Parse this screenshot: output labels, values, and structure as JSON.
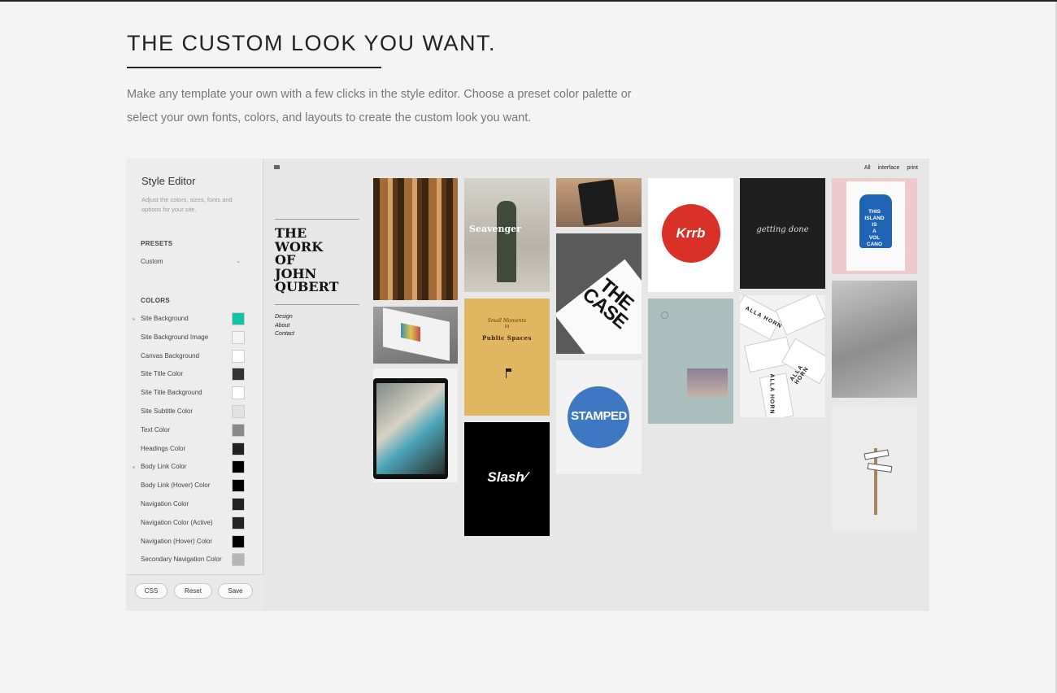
{
  "hero": {
    "title": "THE CUSTOM LOOK YOU WANT.",
    "body": "Make any template your own with a few clicks in the style editor. Choose a preset color palette or select your own fonts, colors, and layouts to create the custom look you want."
  },
  "style_editor": {
    "title": "Style Editor",
    "description": "Adjust the colors, sizes, fonts and options for your site.",
    "presets_heading": "PRESETS",
    "preset_value": "Custom",
    "colors_heading": "COLORS",
    "colors": [
      {
        "label": "Site Background",
        "color": "#10c3a4"
      },
      {
        "label": "Site Background Image",
        "color": "#f4f4f4"
      },
      {
        "label": "Canvas Background",
        "color": "#ffffff"
      },
      {
        "label": "Site Title Color",
        "color": "#333333"
      },
      {
        "label": "Site Title Background",
        "color": "#ffffff"
      },
      {
        "label": "Site Subtitle Color",
        "color": "#e2e2e2"
      },
      {
        "label": "Text Color",
        "color": "#8a8a8a"
      },
      {
        "label": "Headings Color",
        "color": "#222222"
      },
      {
        "label": "Body Link Color",
        "color": "#000000"
      },
      {
        "label": "Body Link (Hover) Color",
        "color": "#000000"
      },
      {
        "label": "Navigation Color",
        "color": "#222222"
      },
      {
        "label": "Navigation Color (Active)",
        "color": "#222222"
      },
      {
        "label": "Navigation (Hover) Color",
        "color": "#000000"
      },
      {
        "label": "Secondary Navigation Color",
        "color": "#b5b5b5"
      }
    ],
    "buttons": {
      "css": "CSS",
      "reset": "Reset",
      "save": "Save"
    }
  },
  "site_preview": {
    "title_lines": [
      "THE",
      "WORK",
      "OF",
      "JOHN",
      "QUBERT"
    ],
    "nav": [
      "Design",
      "About",
      "Contact"
    ],
    "filters": [
      "All",
      "interface",
      "print"
    ],
    "tiles": {
      "seavenger": "Seavenger",
      "small_moments": "Small Moments",
      "small_moments_in": "in",
      "public_spaces": "Public Spaces",
      "slash": "Slash∕",
      "the_case": "THE CASE",
      "stamped": "STAMPED",
      "krrb": "Krrb",
      "getting_done": "getting done",
      "alla_horn": "ALLA HORN",
      "island_lines": [
        "THIS",
        "ISLAND",
        "IS",
        "A",
        "VOL",
        "CANO"
      ]
    }
  }
}
